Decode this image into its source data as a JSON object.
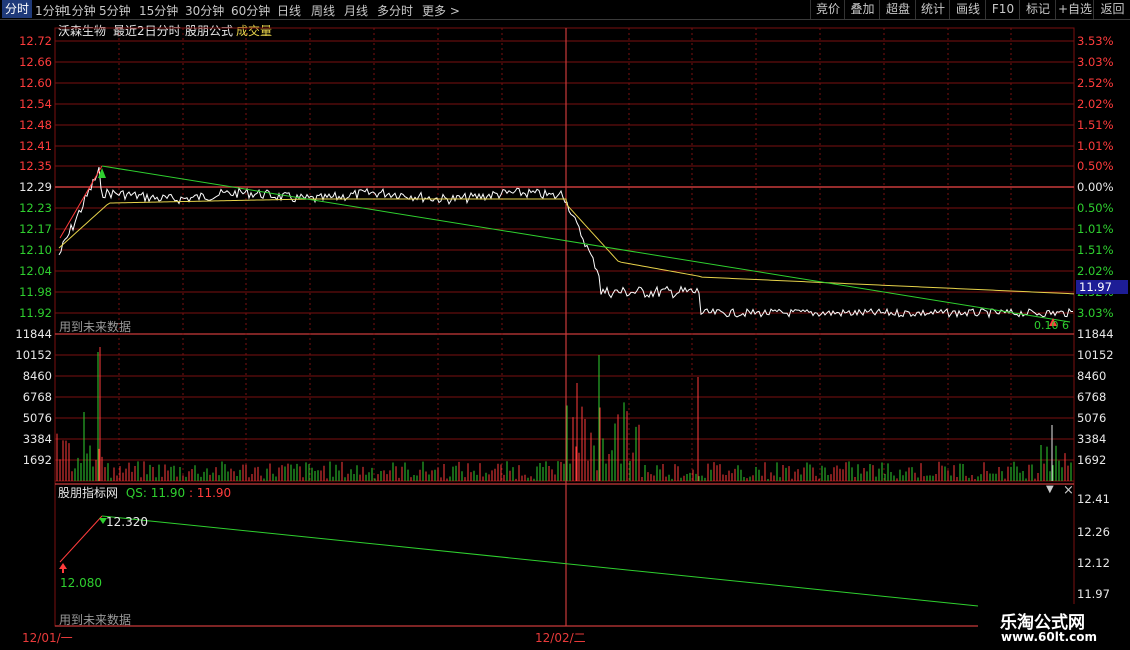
{
  "toolbar": {
    "periods": [
      "分时",
      "1分钟",
      "5分钟",
      "15分钟",
      "30分钟",
      "60分钟",
      "日线",
      "周线",
      "月线",
      "多分时",
      "更多 >"
    ],
    "tools": [
      "竞价",
      "叠加",
      "超盘",
      "统计",
      "画线",
      "F10",
      "标记",
      "+自选",
      "返回"
    ]
  },
  "header": {
    "stock_name": "沃森生物",
    "period_label": "最近2日分时",
    "formula": "股朋公式",
    "volume_label": "成交量"
  },
  "price_axis": {
    "left": [
      "12.72",
      "12.66",
      "12.60",
      "12.54",
      "12.48",
      "12.41",
      "12.35",
      "12.29",
      "12.23",
      "12.17",
      "12.10",
      "12.04",
      "11.98",
      "11.92"
    ],
    "right": [
      "3.53%",
      "3.03%",
      "2.52%",
      "2.02%",
      "1.51%",
      "1.01%",
      "0.50%",
      "0.00%",
      "0.50%",
      "1.01%",
      "1.51%",
      "2.02%",
      "2.52%",
      "3.03%"
    ],
    "current_price": "11.97",
    "overlay_text": "0.10 6"
  },
  "volume_axis": [
    "11844",
    "10152",
    "8460",
    "6768",
    "5076",
    "3384",
    "1692"
  ],
  "future_note": "用到未来数据",
  "indicator": {
    "name": "股朋指标网",
    "qs_label": "QS: 11.90",
    "qs_value": ": 11.90",
    "axis": [
      "12.41",
      "12.26",
      "12.12",
      "11.97"
    ],
    "low_label": "12.080",
    "high_label": "12.320",
    "future_note": "用到未来数据"
  },
  "dates": [
    "12/01/一",
    "12/02/二"
  ],
  "watermark": {
    "title": "乐淘公式网",
    "url": "www.60lt.com"
  },
  "colors": {
    "up": "#ff3c3c",
    "down": "#2fd02f",
    "grid": "#7a1010",
    "price": "#ffffff",
    "avg": "#e6d24a",
    "trend": "#2fd02f"
  }
}
